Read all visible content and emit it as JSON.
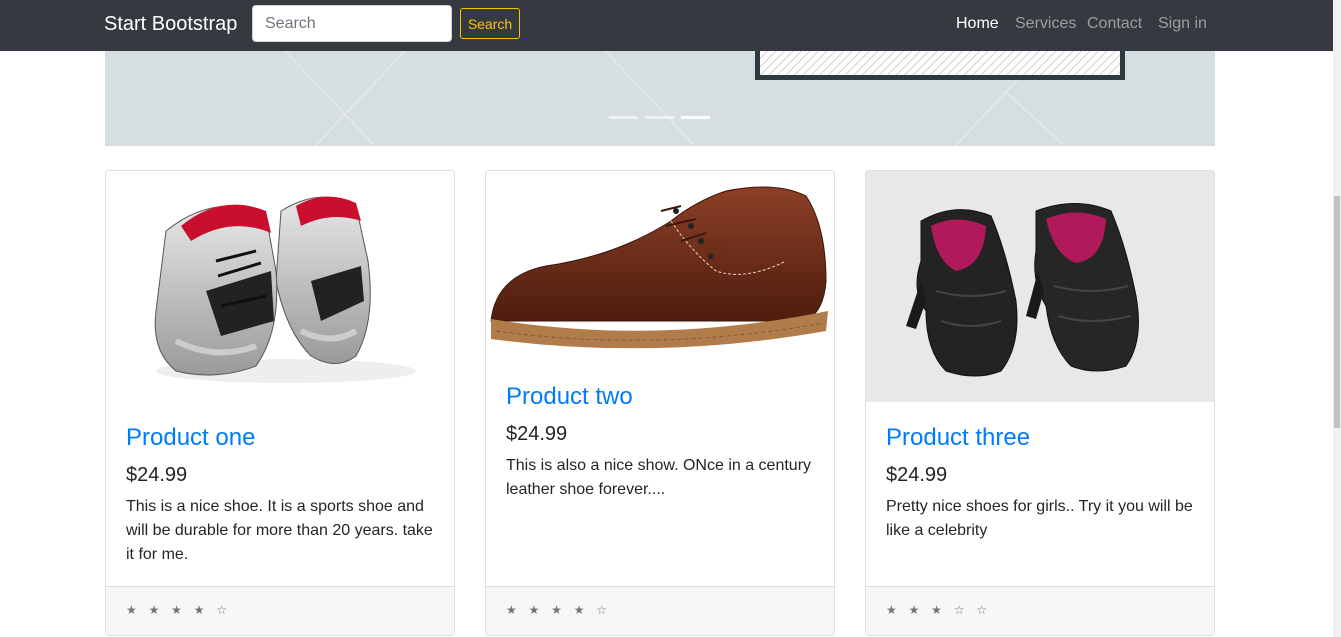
{
  "navbar": {
    "brand": "Start Bootstrap",
    "search_placeholder": "Search",
    "search_button": "Search",
    "links": [
      "Home",
      "Services",
      "Contact",
      "Sign in"
    ],
    "active_link": "Home"
  },
  "carousel": {
    "indicator_count": 3,
    "active_index": 2
  },
  "products": [
    {
      "title": "Product one",
      "price": "$24.99",
      "description": "This is a nice shoe. It is a sports shoe and will be durable for more than 20 years. take it for me.",
      "rating_text": "★ ★ ★ ★ ☆",
      "rating": 4,
      "image": "sports-sneakers-image"
    },
    {
      "title": "Product two",
      "price": "$24.99",
      "description": "This is also a nice show. ONce in a century leather shoe forever....",
      "rating_text": "★ ★ ★ ★ ☆",
      "rating": 4,
      "image": "brown-leather-shoe-image"
    },
    {
      "title": "Product three",
      "price": "$24.99",
      "description": "Pretty nice shoes for girls.. Try it you will be like a celebrity",
      "rating_text": "★ ★ ★ ☆ ☆",
      "rating": 3,
      "image": "black-heeled-shoes-image"
    }
  ],
  "colors": {
    "navbar_bg": "#343a40",
    "link_blue": "#007bff",
    "search_outline": "#ffc107",
    "carousel_bg": "#d7dee1"
  }
}
